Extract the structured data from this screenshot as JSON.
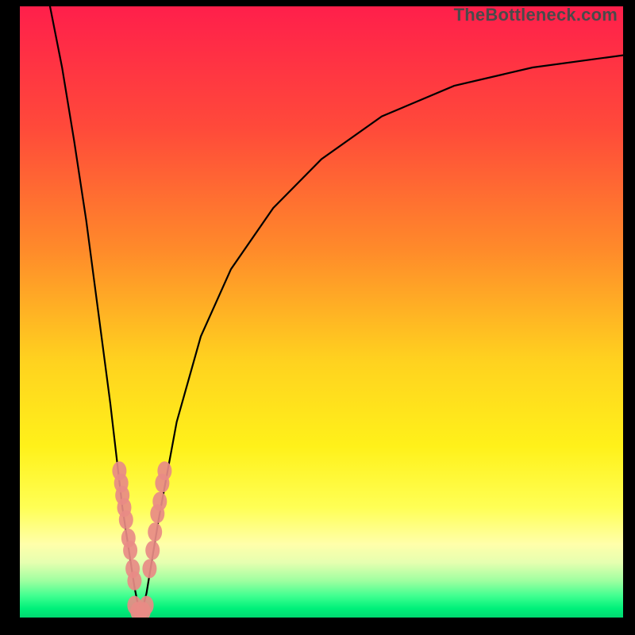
{
  "watermark": "TheBottleneck.com",
  "chart_data": {
    "type": "line",
    "title": "",
    "xlabel": "",
    "ylabel": "",
    "xlim": [
      0,
      100
    ],
    "ylim": [
      0,
      100
    ],
    "grid": false,
    "legend": false,
    "background_gradient": {
      "stops": [
        {
          "offset": 0.0,
          "color": "#ff1f4b"
        },
        {
          "offset": 0.2,
          "color": "#ff4a3a"
        },
        {
          "offset": 0.4,
          "color": "#ff8b2a"
        },
        {
          "offset": 0.58,
          "color": "#ffd21f"
        },
        {
          "offset": 0.72,
          "color": "#fff11a"
        },
        {
          "offset": 0.82,
          "color": "#ffff55"
        },
        {
          "offset": 0.88,
          "color": "#ffffaa"
        },
        {
          "offset": 0.91,
          "color": "#e6ffb0"
        },
        {
          "offset": 0.94,
          "color": "#9effa0"
        },
        {
          "offset": 0.965,
          "color": "#3fff90"
        },
        {
          "offset": 0.985,
          "color": "#00f07a"
        },
        {
          "offset": 1.0,
          "color": "#00d870"
        }
      ]
    },
    "series": [
      {
        "name": "bottleneck-curve",
        "notch_x": 20,
        "points": [
          {
            "x": 5,
            "y": 100
          },
          {
            "x": 7,
            "y": 90
          },
          {
            "x": 9,
            "y": 78
          },
          {
            "x": 11,
            "y": 65
          },
          {
            "x": 13,
            "y": 50
          },
          {
            "x": 15,
            "y": 35
          },
          {
            "x": 17,
            "y": 18
          },
          {
            "x": 19,
            "y": 5
          },
          {
            "x": 20,
            "y": 0
          },
          {
            "x": 21,
            "y": 4
          },
          {
            "x": 23,
            "y": 16
          },
          {
            "x": 26,
            "y": 32
          },
          {
            "x": 30,
            "y": 46
          },
          {
            "x": 35,
            "y": 57
          },
          {
            "x": 42,
            "y": 67
          },
          {
            "x": 50,
            "y": 75
          },
          {
            "x": 60,
            "y": 82
          },
          {
            "x": 72,
            "y": 87
          },
          {
            "x": 85,
            "y": 90
          },
          {
            "x": 100,
            "y": 92
          }
        ]
      },
      {
        "name": "left-branch-markers",
        "points": [
          {
            "x": 16.5,
            "y": 24
          },
          {
            "x": 16.8,
            "y": 22
          },
          {
            "x": 17.0,
            "y": 20
          },
          {
            "x": 17.3,
            "y": 18
          },
          {
            "x": 17.6,
            "y": 16
          },
          {
            "x": 18.0,
            "y": 13
          },
          {
            "x": 18.3,
            "y": 11
          },
          {
            "x": 18.7,
            "y": 8
          },
          {
            "x": 19.0,
            "y": 6
          }
        ]
      },
      {
        "name": "right-branch-markers",
        "points": [
          {
            "x": 21.5,
            "y": 8
          },
          {
            "x": 22.0,
            "y": 11
          },
          {
            "x": 22.4,
            "y": 14
          },
          {
            "x": 22.8,
            "y": 17
          },
          {
            "x": 23.2,
            "y": 19
          },
          {
            "x": 23.6,
            "y": 22
          },
          {
            "x": 24.0,
            "y": 24
          }
        ]
      },
      {
        "name": "bottom-markers",
        "points": [
          {
            "x": 19.0,
            "y": 2
          },
          {
            "x": 19.5,
            "y": 1
          },
          {
            "x": 20.0,
            "y": 1
          },
          {
            "x": 20.5,
            "y": 1
          },
          {
            "x": 21.0,
            "y": 2
          }
        ]
      }
    ]
  }
}
